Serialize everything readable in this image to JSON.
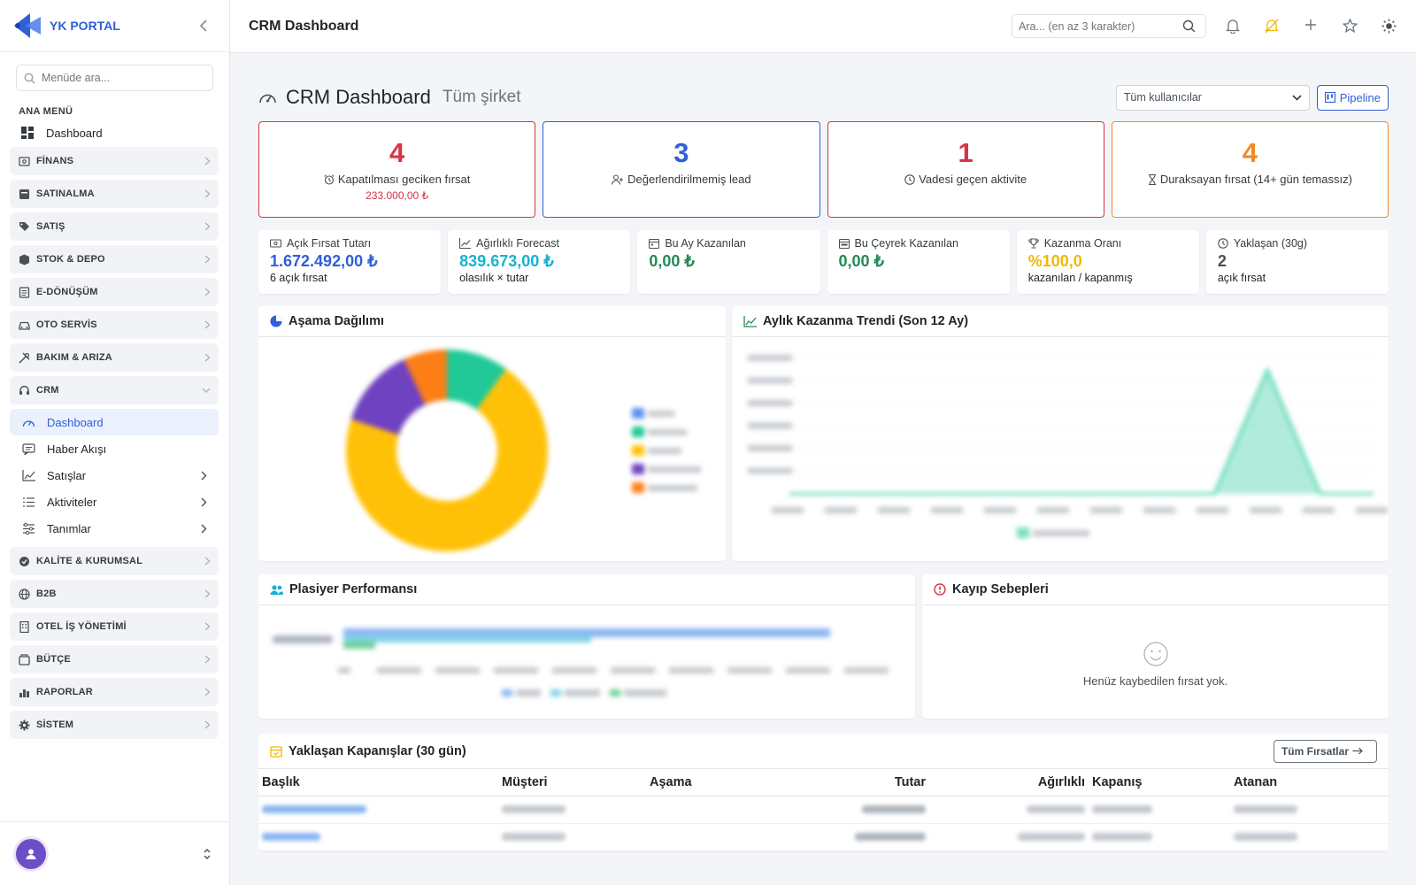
{
  "brand": {
    "name": "YK PORTAL"
  },
  "sidebar": {
    "search_placeholder": "Menüde ara...",
    "section": "ANA MENÜ",
    "dashboard": "Dashboard",
    "groups": [
      "FİNANS",
      "SATINALMA",
      "SATIŞ",
      "STOK & DEPO",
      "E-DÖNÜŞÜM",
      "OTO SERVİS",
      "BAKIM & ARIZA"
    ],
    "crm": {
      "label": "CRM",
      "items": [
        "Dashboard",
        "Haber Akışı",
        "Satışlar",
        "Aktiviteler",
        "Tanımlar"
      ]
    },
    "groups2": [
      "KALİTE & KURUMSAL",
      "B2B",
      "OTEL İŞ YÖNETİMİ",
      "BÜTÇE",
      "RAPORLAR",
      "SİSTEM"
    ]
  },
  "topbar": {
    "title": "CRM Dashboard",
    "search_placeholder": "Ara... (en az 3 karakter)"
  },
  "page": {
    "title": "CRM Dashboard",
    "subtitle": "Tüm şirket",
    "user_select": "Tüm kullanıcılar",
    "pipeline_button": "Pipeline"
  },
  "alerts": [
    {
      "value": "4",
      "label": "Kapatılması geciken fırsat",
      "amount": "233.000,00 ₺",
      "color": "#d63447",
      "icon": "alarm-clock-icon"
    },
    {
      "value": "3",
      "label": "Değerlendirilmemiş lead",
      "color": "#2f5fd9",
      "icon": "user-plus-icon"
    },
    {
      "value": "1",
      "label": "Vadesi geçen aktivite",
      "color": "#d63447",
      "icon": "clock-icon"
    },
    {
      "value": "4",
      "label": "Duraksayan fırsat (14+ gün temassız)",
      "color": "#f08a24",
      "icon": "hourglass-icon"
    }
  ],
  "kpis": [
    {
      "label": "Açık Fırsat Tutarı",
      "value": "1.672.492,00 ₺",
      "sub": "6 açık fırsat",
      "color": "#2f5fd9",
      "icon": "cash-icon"
    },
    {
      "label": "Ağırlıklı Forecast",
      "value": "839.673,00 ₺",
      "sub": "olasılık × tutar",
      "color": "#17b1d4",
      "icon": "trend-icon"
    },
    {
      "label": "Bu Ay Kazanılan",
      "value": "0,00 ₺",
      "sub": "",
      "color": "#238a55",
      "icon": "calendar-month-icon"
    },
    {
      "label": "Bu Çeyrek Kazanılan",
      "value": "0,00 ₺",
      "sub": "",
      "color": "#238a55",
      "icon": "calendar-range-icon"
    },
    {
      "label": "Kazanma Oranı",
      "value": "%100,0",
      "sub": "kazanılan / kapanmış",
      "color": "#f2b705",
      "icon": "trophy-icon"
    },
    {
      "label": "Yaklaşan (30g)",
      "value": "2",
      "sub": "açık fırsat",
      "color": "#495057",
      "icon": "clock-icon"
    }
  ],
  "cards": {
    "stage": "Aşama Dağılımı",
    "trend": "Aylık Kazanma Trendi (Son 12 Ay)",
    "sales": "Plasiyer Performansı",
    "loss": "Kayıp Sebepleri",
    "loss_empty": "Henüz kaybedilen fırsat yok.",
    "upcoming": "Yaklaşan Kapanışlar (30 gün)",
    "all_button": "Tüm Fırsatlar"
  },
  "table": {
    "headers": [
      "Başlık",
      "Müşteri",
      "Aşama",
      "Tutar",
      "Ağırlıklı",
      "Kapanış",
      "Atanan"
    ]
  },
  "chart_data": [
    {
      "type": "pie",
      "title": "Aşama Dağılımı",
      "slices": [
        {
          "color": "#20c997",
          "value": 10
        },
        {
          "color": "#ffc107",
          "value": 70
        },
        {
          "color": "#6f42c1",
          "value": 13
        },
        {
          "color": "#fd7e14",
          "value": 7
        }
      ]
    },
    {
      "type": "area",
      "title": "Aylık Kazanma Trendi (Son 12 Ay)",
      "values": [
        0,
        0,
        0,
        0,
        0,
        0,
        0,
        0,
        0,
        6,
        0,
        0
      ],
      "color": "#20c997"
    }
  ]
}
